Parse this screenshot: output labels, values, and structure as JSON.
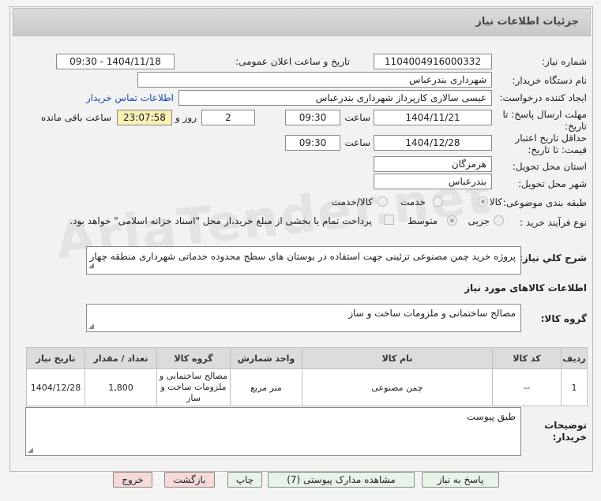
{
  "header": {
    "title": "جزئیات اطلاعات نیاز"
  },
  "form": {
    "need_number_label": "شماره نیاز:",
    "need_number": "1104004916000332",
    "announce_label": "تاریخ و ساعت اعلان عمومی:",
    "announce_value": "1404/11/18 - 09:30",
    "buyer_org_label": "نام دستگاه خریدار:",
    "buyer_org": "شهرداری بندرعباس",
    "creator_label": "ایجاد کننده درخواست:",
    "creator": "عیسی سالاری کارپرداز شهرداری بندرعباس",
    "contact_link": "اطلاعات تماس خریدار",
    "deadline_label_1": "مهلت ارسال پاسخ: تا",
    "deadline_label_2": "تاریخ:",
    "deadline_date": "1404/11/21",
    "time_label": "ساعت",
    "deadline_time": "09:30",
    "days_value": "2",
    "days_label": "روز و",
    "remaining_time": "23:07:58",
    "remaining_label": "ساعت باقی مانده",
    "validity_label_1": "حداقل تاریخ اعتبار",
    "validity_label_2": "قیمت: تا تاریخ:",
    "validity_date": "1404/12/28",
    "validity_time": "09:30",
    "province_label": "استان محل تحویل:",
    "province": "هرمزگان",
    "city_label": "شهر محل تحویل:",
    "city": "بندرعباس",
    "category_label": "طبقه بندی موضوعی:",
    "category_options": [
      "کالا",
      "خدمت",
      "کالا/خدمت"
    ],
    "purchase_label": "نوع فرآیند خرید :",
    "purchase_options": [
      "جزیی",
      "متوسط"
    ],
    "payment_note": "پرداخت تمام یا بخشی از مبلغ خرید،از محل \"اسناد خزانه اسلامی\" خواهد بود."
  },
  "description": {
    "label": "شرح کلي نياز:",
    "text": "پروژه خرید چمن مصنوعی تزئینی جهت استفاده در بوستان های سطح محدوده خدماتی شهرداری منطقه چهار"
  },
  "goods_info_title": "اطلاعات کالاهای مورد نیاز",
  "goods_group": {
    "label": "گروه کالا:",
    "value": "مصالح ساختمانی و ملزومات ساخت و ساز"
  },
  "table": {
    "headers": [
      "ردیف",
      "کد کالا",
      "نام کالا",
      "واحد شمارش",
      "گروه کالا",
      "تعداد / مقدار",
      "تاریخ نیاز"
    ],
    "rows": [
      [
        "1",
        "--",
        "چمن مصنوعی",
        "متر مربع",
        "مصالح ساختمانی و ملزومات ساخت و ساز",
        "1,800",
        "1404/12/28"
      ]
    ]
  },
  "buyer_notes": {
    "label_1": "توضیحات",
    "label_2": "خریدار:",
    "text": "طبق پیوست"
  },
  "buttons": {
    "reply": "پاسخ به نیاز",
    "attachments": "مشاهده مدارک پیوستی (7)",
    "print": "چاپ",
    "back": "بازگشت",
    "exit": "خروج"
  },
  "watermark": "AriaTender.net"
}
